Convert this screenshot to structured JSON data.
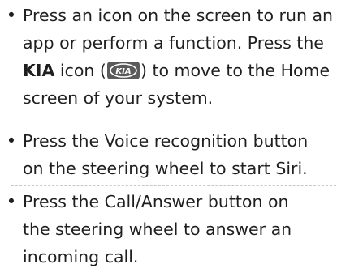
{
  "bullets": [
    {
      "lines": [
        "Press an icon on the screen to run an",
        "app or perform a function. Press the"
      ],
      "line3_bold": "KIA",
      "line3_mid": " icon (",
      "line3_end": ") to move to the Home",
      "line4": "screen of your system."
    },
    {
      "lines": [
        "Press the Voice recognition button",
        "on the steering wheel to start Siri."
      ]
    },
    {
      "lines": [
        "Press the Call/Answer button on",
        "the steering wheel to answer an",
        "incoming call."
      ]
    }
  ],
  "bullet_symbol": "•",
  "kia_icon": {
    "name": "kia-logo-icon",
    "text": "KIA",
    "color": "#5a5a5a"
  }
}
